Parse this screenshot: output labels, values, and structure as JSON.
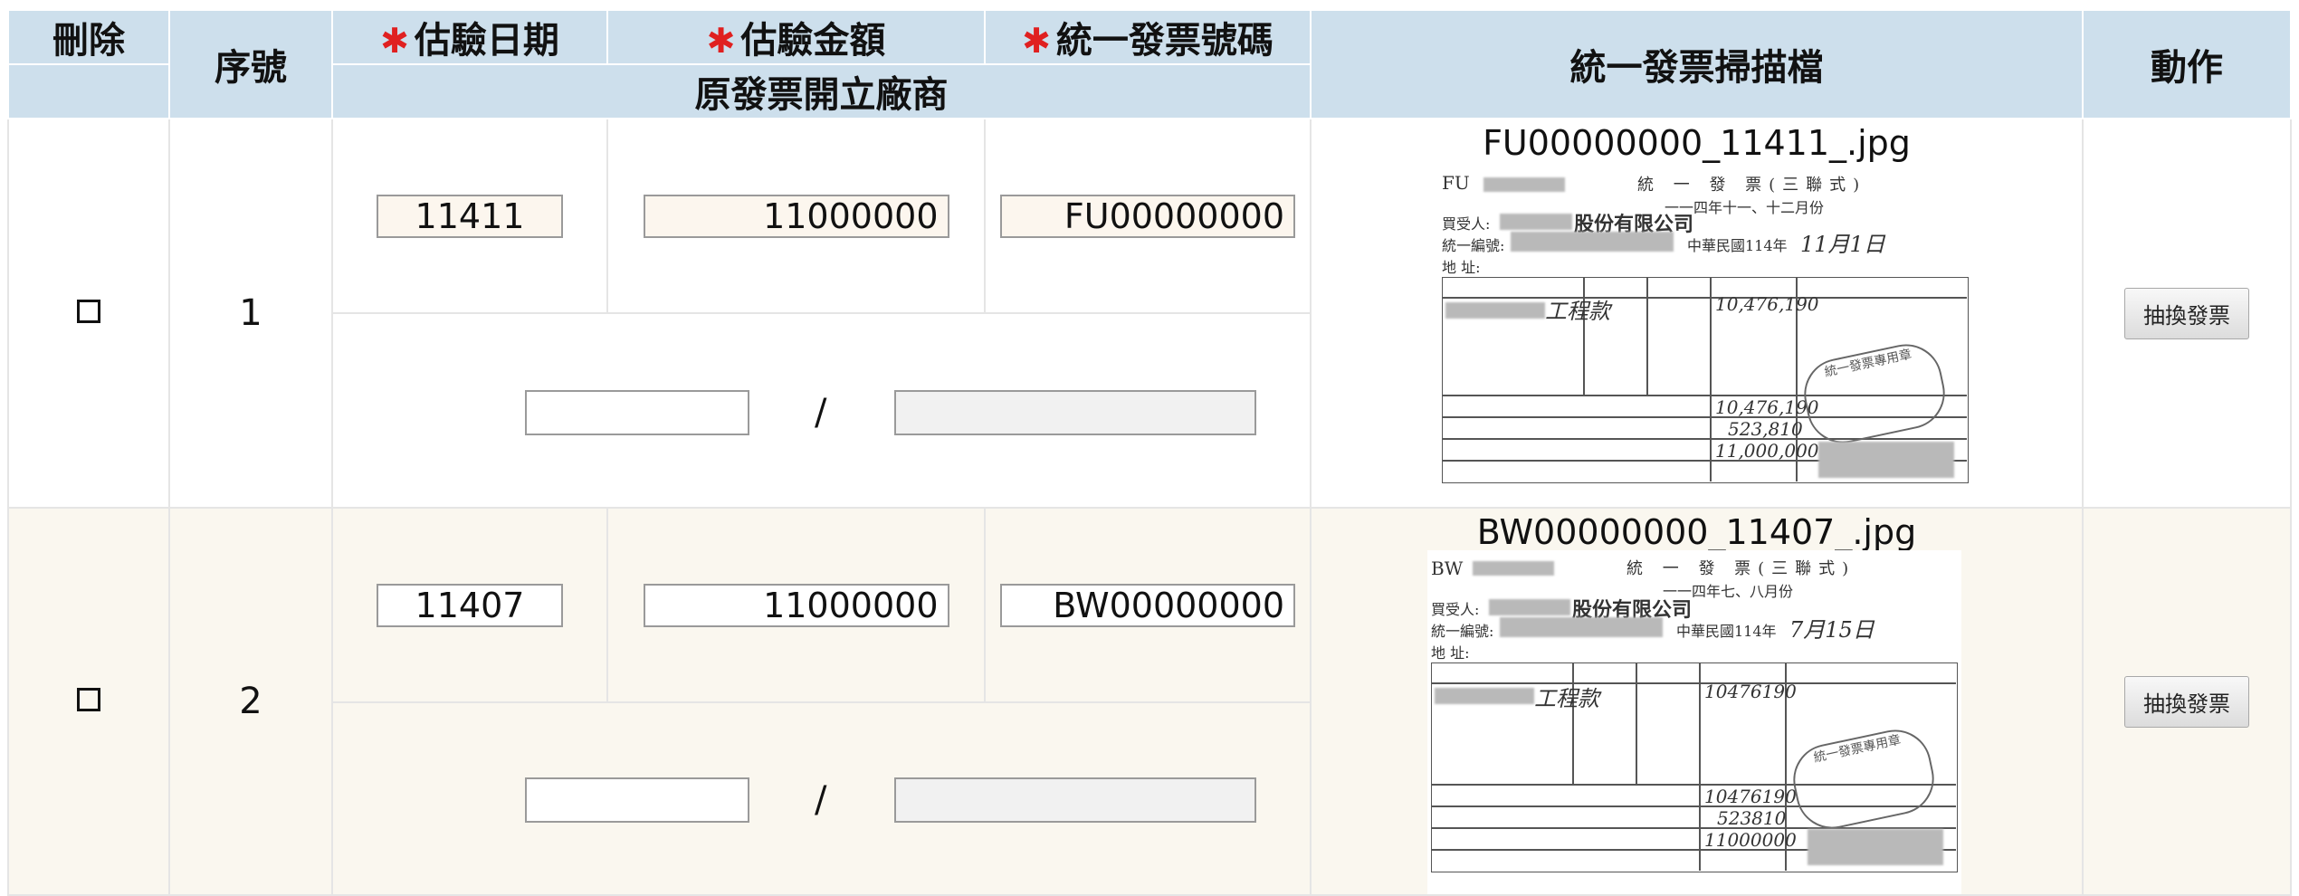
{
  "headers": {
    "delete": "刪除",
    "seq": "序號",
    "est_date": "估驗日期",
    "est_amount": "估驗金額",
    "invoice_no": "統一發票號碼",
    "vendor": "原發票開立廠商",
    "scan": "統一發票掃描檔",
    "action": "動作",
    "required_mark": "✱"
  },
  "rows": [
    {
      "delete_box": "☐",
      "seq": "1",
      "est_date": "11411",
      "est_amount": "11000000",
      "invoice_no": "FU00000000",
      "vendor_code": "",
      "vendor_name": "",
      "separator": "/",
      "scan_file": "FU00000000_11411_.jpg",
      "invoice_prefix": "FU",
      "invoice_period": "一一四年十一、十二月份",
      "buyer": "股份有限公司",
      "date_hand": "11月1日",
      "item": "工程款",
      "total_hand": "10,476,190",
      "tax_hand": "523,810",
      "grand_hand": "11,000,000",
      "action_label": "抽換發票"
    },
    {
      "delete_box": "☐",
      "seq": "2",
      "est_date": "11407",
      "est_amount": "11000000",
      "invoice_no": "BW00000000",
      "vendor_code": "",
      "vendor_name": "",
      "separator": "/",
      "scan_file": "BW00000000_11407_.jpg",
      "invoice_prefix": "BW",
      "invoice_period": "一一四年七、八月份",
      "buyer": "股份有限公司",
      "date_hand": "7月15日",
      "item": "工程款",
      "total_hand": "10476190",
      "tax_hand": "523810",
      "grand_hand": "11000000",
      "action_label": "抽換發票"
    }
  ],
  "colors": {
    "header_bg": "#cddfec",
    "row_alt_bg": "#faf7ef",
    "required": "#e02020"
  }
}
